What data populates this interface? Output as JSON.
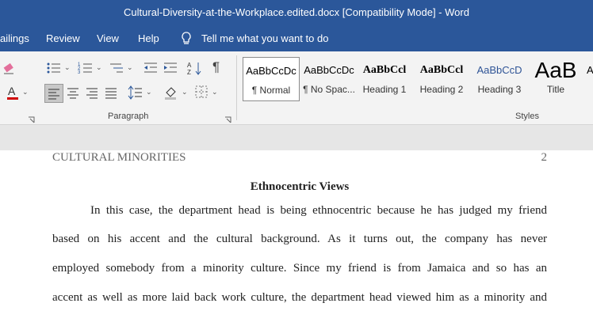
{
  "window": {
    "title": "Cultural-Diversity-at-the-Workplace.edited.docx [Compatibility Mode] - Word"
  },
  "menu": [
    {
      "label": "ailings"
    },
    {
      "label": "Review"
    },
    {
      "label": "View"
    },
    {
      "label": "Help"
    }
  ],
  "tell_me": {
    "label": "Tell me what you want to do",
    "icon": "lightbulb-icon"
  },
  "ribbon": {
    "paragraph_label": "Paragraph",
    "styles_label": "Styles",
    "styles": [
      {
        "preview": "AaBbCcDc",
        "name": "¶ Normal"
      },
      {
        "preview": "AaBbCcDc",
        "name": "¶ No Spac..."
      },
      {
        "preview": "AaBbCcl",
        "name": "Heading 1"
      },
      {
        "preview": "AaBbCcl",
        "name": "Heading 2"
      },
      {
        "preview": "AaBbCcD",
        "name": "Heading 3"
      },
      {
        "preview": "AaB",
        "name": "Title"
      },
      {
        "preview": "A",
        "name": ""
      }
    ],
    "colors": {
      "ribbon_blue": "#2b579a",
      "font_color": "#d00000",
      "heading_blue": "#2f5496"
    }
  },
  "document": {
    "header_left": "CULTURAL MINORITIES",
    "header_page": "2",
    "heading": "Ethnocentric Views",
    "lines": [
      "In this case, the department head is being ethnocentric because he has judged my friend",
      "based on his accent and the cultural background. As it turns out, the company has never",
      "employed somebody from a minority culture. Since my friend is from Jamaica and so has an",
      "accent as well as more laid back work culture, the department head viewed him as a minority and"
    ]
  }
}
